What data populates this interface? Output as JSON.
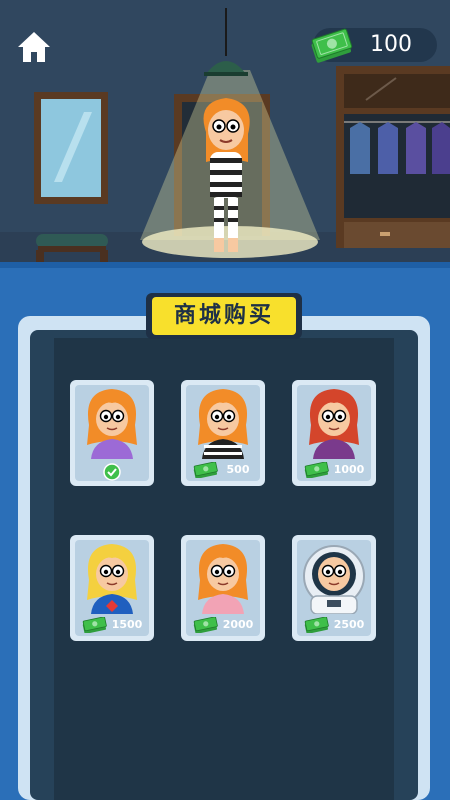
{
  "hud": {
    "money": "100"
  },
  "shop": {
    "title": "商城购买",
    "items": [
      {
        "price": "",
        "owned": true,
        "hair": "#f28c28",
        "top": "#9c6ad6"
      },
      {
        "price": "500",
        "owned": false,
        "hair": "#f28c28",
        "top": "#222222"
      },
      {
        "price": "1000",
        "owned": false,
        "hair": "#d4452b",
        "top": "#7a3a8c"
      },
      {
        "price": "1500",
        "owned": false,
        "hair": "#f4d03f",
        "top": "#1f5fbf"
      },
      {
        "price": "2000",
        "owned": false,
        "hair": "#f28c28",
        "top": "#f2a3b5"
      },
      {
        "price": "2500",
        "owned": false,
        "hair": "#f28c28",
        "top": "#ffffff"
      }
    ]
  },
  "colors": {
    "room_wall": "#30475f",
    "shop_background": "#2b6fb8",
    "title_banner": "#f8e02c",
    "money_green": "#3fbf4a"
  },
  "icons": {
    "home": "home-icon",
    "money": "money-stack-icon",
    "owned": "check-circle-icon"
  }
}
